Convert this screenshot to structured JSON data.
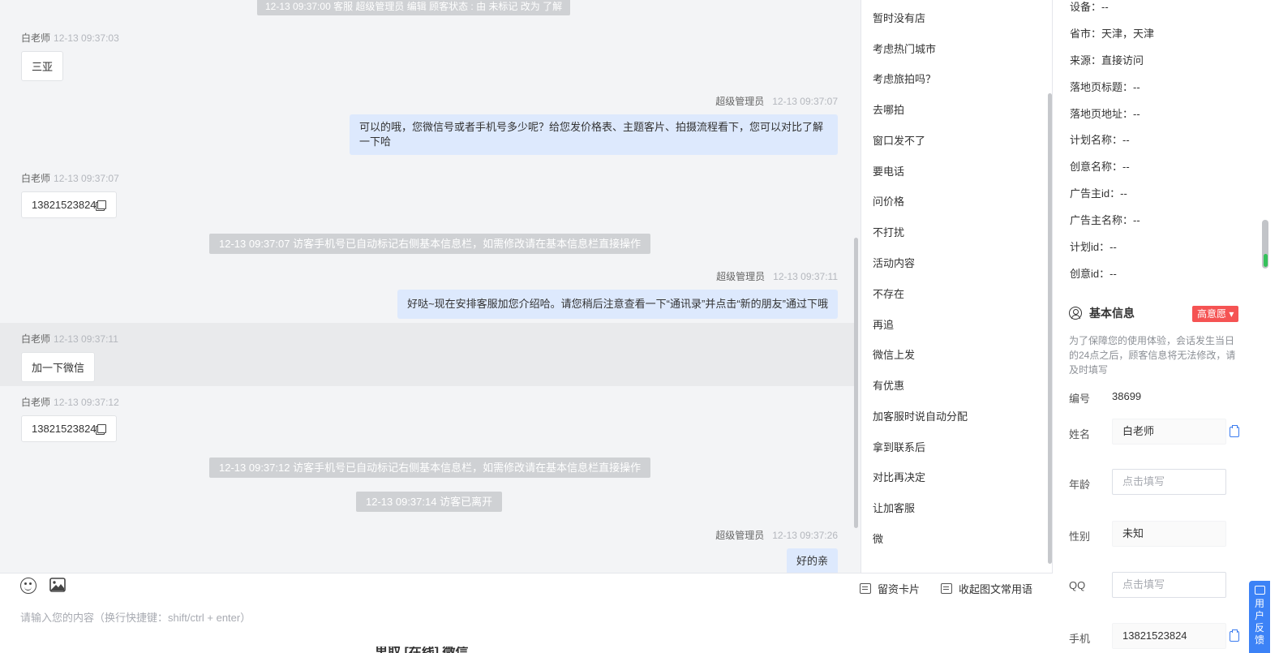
{
  "chat": {
    "top_system": "12-13 09:37:00 客服 超级管理员 编辑 顾客状态 : 由 未标记 改为 了解",
    "messages": [
      {
        "sender": "白老师",
        "time": "12-13 09:37:03",
        "text": "三亚"
      },
      {
        "sender": "超级管理员",
        "time": "12-13 09:37:07",
        "text": "可以的哦，您微信号或者手机号多少呢？给您发价格表、主题客片、拍摄流程看下，您可以对比了解一下哈"
      },
      {
        "sender": "白老师",
        "time": "12-13 09:37:07",
        "text": "13821523824"
      },
      {
        "system": "12-13 09:37:07 访客手机号已自动标记右侧基本信息栏，如需修改请在基本信息栏直接操作"
      },
      {
        "sender": "超级管理员",
        "time": "12-13 09:37:11",
        "text": "好哒~现在安排客服加您介绍哈。请您稍后注意查看一下“通讯录”并点击“新的朋友”通过下哦"
      },
      {
        "sender": "白老师",
        "time": "12-13 09:37:11",
        "text": "加一下微信"
      },
      {
        "sender": "白老师",
        "time": "12-13 09:37:12",
        "text": "13821523824"
      },
      {
        "system": "12-13 09:37:12 访客手机号已自动标记右侧基本信息栏，如需修改请在基本信息栏直接操作"
      },
      {
        "system": "12-13 09:37:14 访客已离开"
      },
      {
        "sender": "超级管理员",
        "time": "12-13 09:37:26",
        "text": "好的亲"
      }
    ]
  },
  "input": {
    "placeholder": "请输入您的内容（换行快捷键：shift/ctrl + enter）",
    "card_button": "留资卡片",
    "collapse_button": "收起图文常用语",
    "bottom_partial": "里取 [在线] 微信"
  },
  "phrases": [
    "暂时没有店",
    "考虑热门城市",
    "考虑旅拍吗？",
    "去哪拍",
    "窗口发不了",
    "要电话",
    "问价格",
    "不打扰",
    "活动内容",
    "不存在",
    "再追",
    "微信上发",
    "有优惠",
    "加客服时说自动分配",
    "拿到联系后",
    "对比再决定",
    "让加客服",
    "微"
  ],
  "info": {
    "source_rows": [
      "设备：--",
      "省市：天津，天津",
      "来源：直接访问",
      "落地页标题：--",
      "落地页地址：--",
      "计划名称：--",
      "创意名称：--",
      "广告主id：--",
      "广告主名称：--",
      "计划id：--",
      "创意id：--"
    ],
    "basic_title": "基本信息",
    "intent_badge": "高意愿",
    "notice": "为了保障您的使用体验，会话发生当日的24点之后，顾客信息将无法修改，请及时填写",
    "fields": {
      "id_label": "编号",
      "id_value": "38699",
      "name_label": "姓名",
      "name_value": "白老师",
      "age_label": "年龄",
      "age_placeholder": "点击填写",
      "gender_label": "性别",
      "gender_value": "未知",
      "qq_label": "QQ",
      "qq_placeholder": "点击填写",
      "phone_label": "手机",
      "phone_value": "13821523824"
    },
    "feedback": "用户反馈"
  },
  "colors": {
    "accent": "#3c82f6",
    "intent_red": "#f55353",
    "agent_bubble": "#dde9fd",
    "system_gray": "#cfd1d4"
  }
}
